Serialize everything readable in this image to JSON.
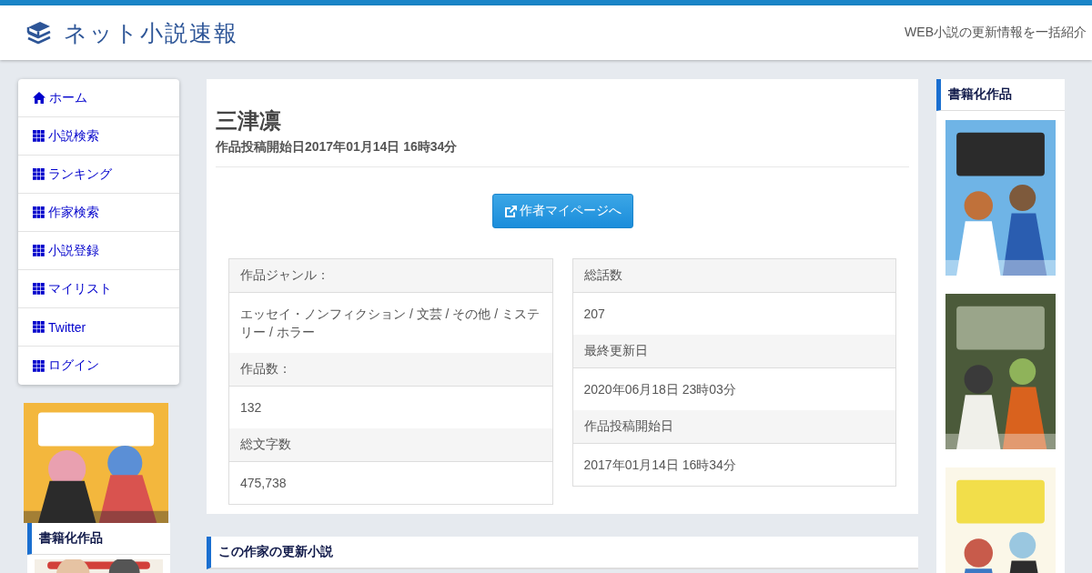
{
  "header": {
    "logo_text": "ネット小説速報",
    "tagline": "WEB小説の更新情報を一括紹介"
  },
  "nav": [
    {
      "kind": "home",
      "label": "ホーム"
    },
    {
      "kind": "grid",
      "label": "小説検索"
    },
    {
      "kind": "grid",
      "label": "ランキング"
    },
    {
      "kind": "grid",
      "label": "作家検索"
    },
    {
      "kind": "grid",
      "label": "小説登録"
    },
    {
      "kind": "grid",
      "label": "マイリスト"
    },
    {
      "kind": "grid",
      "label": "Twitter"
    },
    {
      "kind": "grid",
      "label": "ログイン"
    }
  ],
  "left_heading": "書籍化作品",
  "author": {
    "name": "三津凛",
    "subtitle": "作品投稿開始日2017年01月14日 16時34分",
    "button": "作者マイページへ"
  },
  "stats": [
    [
      {
        "label": "作品ジャンル：",
        "value": "エッセイ・ノンフィクション / 文芸 / その他 / ミステリー / ホラー"
      },
      {
        "label": "作品数：",
        "value": "132"
      },
      {
        "label": "総文字数",
        "value": "475,738"
      }
    ],
    [
      {
        "label": "総話数",
        "value": "207"
      },
      {
        "label": "最終更新日",
        "value": "2020年06月18日 23時03分"
      },
      {
        "label": "作品投稿開始日",
        "value": "2017年01月14日 16時34分"
      }
    ]
  ],
  "section_heading": "この作家の更新小説",
  "right_heading": "書籍化作品"
}
